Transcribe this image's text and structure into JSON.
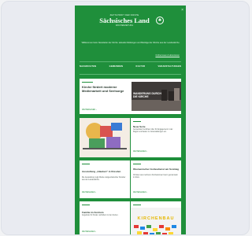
{
  "close_glyph": "×",
  "brand": {
    "top": "ZEITSCHRIFT DER KIRCHE",
    "name": "Sächsisches Land",
    "sub": "WOCHENZEITUNG",
    "emblem": "♣"
  },
  "intro": {
    "text": "Willkommen beim Newsletter der Kirche: aktuelle Meldungen und Beiträge der Woche aus der Landeskirche.",
    "link": "Online lesen & abonnieren"
  },
  "nav": [
    "NACHRICHTEN",
    "GEMEINDEN",
    "KULTUR",
    "VERANSTALTUNGEN"
  ],
  "feature": {
    "title": "Kirche fördert moderne Medienarbeit und Seelsorge",
    "image_caption": "WANDERUNG DURCH DIE KIRCHE",
    "meta": "WEITERLESEN ›"
  },
  "tiles": [
    {
      "name": "art-tile",
      "title": "",
      "text": "",
      "link": ""
    },
    {
      "name": "news-tile-1",
      "title": "Neue Serie",
      "text": "Gemeinden berichten über ihr Engagement in der Region und laden zu Veranstaltungen ein.",
      "link": "WEITERLESEN ›"
    },
    {
      "name": "news-tile-2",
      "title": "Ausstellung „Glauben“ in Dresden",
      "text": "Die Ausstellung zeigt Werke zeitgenössischer Künstler aus der Landeskirche.",
      "link": "WEITERLESEN ›"
    },
    {
      "name": "news-tile-3",
      "title": "Ökumenischer Gottesdienst am Sonntag",
      "text": "Christen aus mehreren Konfessionen feiern gemeinsam im Dom.",
      "link": "WEITERLESEN ›"
    },
    {
      "name": "news-tile-4",
      "title": "Familie im Zentrum",
      "text": "Angebote für Kinder und Eltern in den Ferien.",
      "link": "WEITERLESEN ›"
    },
    {
      "name": "lego-tile",
      "title": "",
      "text": "",
      "link": ""
    }
  ],
  "lego_word": "KIRCHENBAU"
}
